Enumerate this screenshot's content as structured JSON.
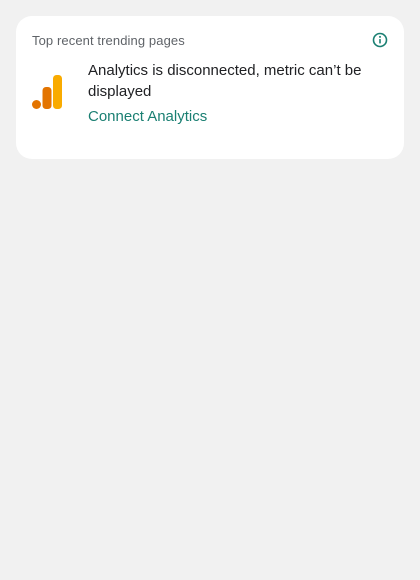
{
  "card": {
    "title": "Top recent trending pages",
    "info_icon": "info-icon",
    "logo_icon": "google-analytics-logo",
    "message": "Analytics is disconnected, metric can’t be displayed",
    "link_label": "Connect Analytics"
  },
  "colors": {
    "background": "#f1f1f1",
    "card": "#ffffff",
    "accent": "#1a7f72",
    "logo_dark": "#e37400",
    "logo_light": "#f9ab00"
  }
}
